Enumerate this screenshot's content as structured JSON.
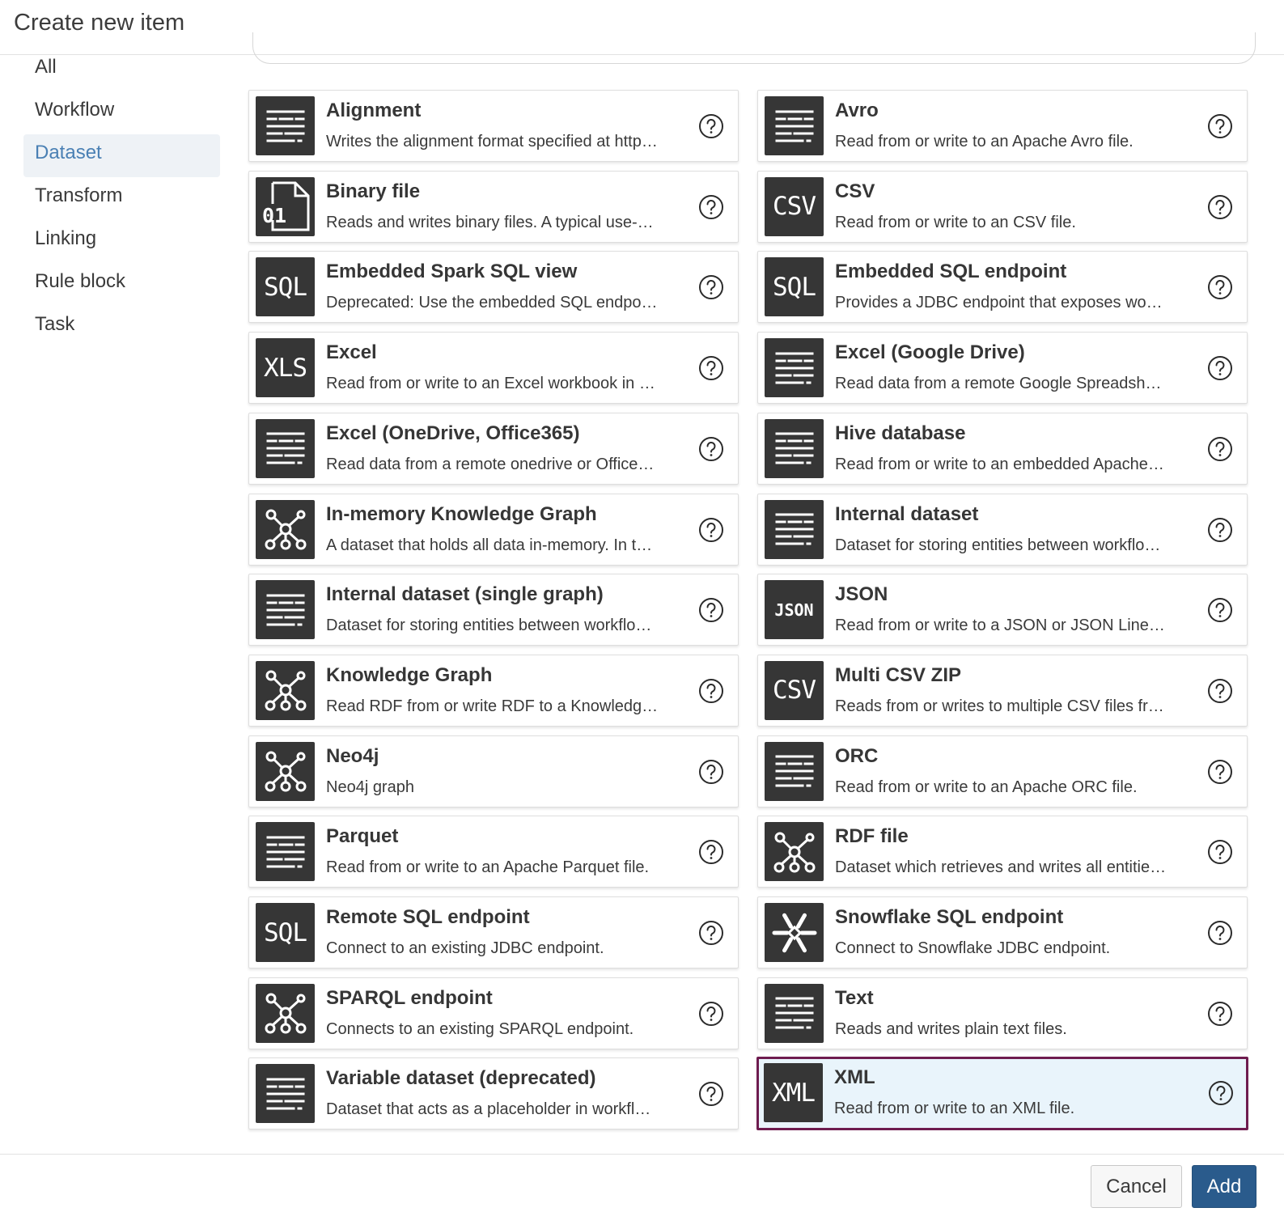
{
  "dialog": {
    "title": "Create new item"
  },
  "sidebar": {
    "items": [
      {
        "label": "All",
        "active": false
      },
      {
        "label": "Workflow",
        "active": false
      },
      {
        "label": "Dataset",
        "active": true
      },
      {
        "label": "Transform",
        "active": false
      },
      {
        "label": "Linking",
        "active": false
      },
      {
        "label": "Rule block",
        "active": false
      },
      {
        "label": "Task",
        "active": false
      }
    ]
  },
  "items": [
    {
      "title": "Alignment",
      "desc": "Writes the alignment format specified at http…",
      "icon": "doc-lines-icon"
    },
    {
      "title": "Avro",
      "desc": "Read from or write to an Apache Avro file.",
      "icon": "doc-lines-icon"
    },
    {
      "title": "Binary file",
      "desc": "Reads and writes binary files. A typical use-…",
      "icon": "binary-file-icon"
    },
    {
      "title": "CSV",
      "desc": "Read from or write to an CSV file.",
      "icon": "csv-icon",
      "icon_text": "CSV"
    },
    {
      "title": "Embedded Spark SQL view",
      "desc": "Deprecated: Use the embedded SQL endpo…",
      "icon": "sql-icon",
      "icon_text": "SQL"
    },
    {
      "title": "Embedded SQL endpoint",
      "desc": "Provides a JDBC endpoint that exposes wo…",
      "icon": "sql-icon",
      "icon_text": "SQL"
    },
    {
      "title": "Excel",
      "desc": "Read from or write to an Excel workbook in …",
      "icon": "xls-icon",
      "icon_text": "XLS"
    },
    {
      "title": "Excel (Google Drive)",
      "desc": "Read data from a remote Google Spreadsh…",
      "icon": "doc-lines-icon"
    },
    {
      "title": "Excel (OneDrive, Office365)",
      "desc": "Read data from a remote onedrive or Office…",
      "icon": "doc-lines-icon"
    },
    {
      "title": "Hive database",
      "desc": "Read from or write to an embedded Apache…",
      "icon": "doc-lines-icon"
    },
    {
      "title": "In-memory Knowledge Graph",
      "desc": "A dataset that holds all data in-memory. In t…",
      "icon": "graph-icon"
    },
    {
      "title": "Internal dataset",
      "desc": "Dataset for storing entities between workflo…",
      "icon": "doc-lines-icon"
    },
    {
      "title": "Internal dataset (single graph)",
      "desc": "Dataset for storing entities between workflo…",
      "icon": "doc-lines-icon"
    },
    {
      "title": "JSON",
      "desc": "Read from or write to a JSON or JSON Line…",
      "icon": "json-icon",
      "icon_text": "JSON"
    },
    {
      "title": "Knowledge Graph",
      "desc": "Read RDF from or write RDF to a Knowledg…",
      "icon": "graph-icon"
    },
    {
      "title": "Multi CSV ZIP",
      "desc": "Reads from or writes to multiple CSV files fr…",
      "icon": "csv-icon",
      "icon_text": "CSV"
    },
    {
      "title": "Neo4j",
      "desc": "Neo4j graph",
      "icon": "graph-icon"
    },
    {
      "title": "ORC",
      "desc": "Read from or write to an Apache ORC file.",
      "icon": "doc-lines-icon"
    },
    {
      "title": "Parquet",
      "desc": "Read from or write to an Apache Parquet file.",
      "icon": "doc-lines-icon"
    },
    {
      "title": "RDF file",
      "desc": "Dataset which retrieves and writes all entitie…",
      "icon": "graph-icon"
    },
    {
      "title": "Remote SQL endpoint",
      "desc": "Connect to an existing JDBC endpoint.",
      "icon": "sql-icon",
      "icon_text": "SQL"
    },
    {
      "title": "Snowflake SQL endpoint",
      "desc": "Connect to Snowflake JDBC endpoint.",
      "icon": "snowflake-icon"
    },
    {
      "title": "SPARQL endpoint",
      "desc": "Connects to an existing SPARQL endpoint.",
      "icon": "graph-icon"
    },
    {
      "title": "Text",
      "desc": "Reads and writes plain text files.",
      "icon": "doc-lines-icon"
    },
    {
      "title": "Variable dataset (deprecated)",
      "desc": "Dataset that acts as a placeholder in workfl…",
      "icon": "doc-lines-icon"
    },
    {
      "title": "XML",
      "desc": "Read from or write to an XML file.",
      "icon": "xml-icon",
      "icon_text": "XML",
      "selected": true
    }
  ],
  "footer": {
    "cancel_label": "Cancel",
    "add_label": "Add"
  },
  "colors": {
    "accent": "#2a5b8c",
    "selection_border": "#6e1c4f",
    "selection_bg": "#e9f4fb",
    "icon_bg": "#363636",
    "active_nav": "#4a80b4"
  }
}
